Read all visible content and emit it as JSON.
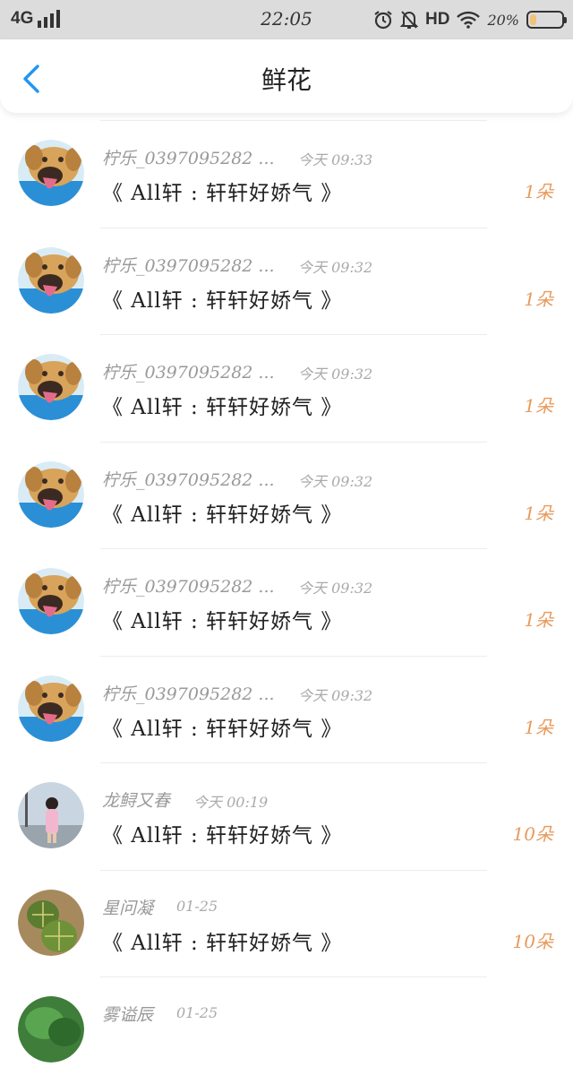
{
  "status_bar": {
    "network": "4G",
    "time": "22:05",
    "hd": "HD",
    "battery_text": "20%",
    "battery_level": 0.2
  },
  "nav": {
    "back_icon": "chevron-left-icon",
    "title": "鲜花",
    "accent_color": "#2196f3"
  },
  "records": [
    {
      "name": "柠乐_0397095282 ...",
      "time": "今天 09:33",
      "message": "《 All轩 :  轩轩好娇气 》",
      "count": "1朵",
      "avatar": "dog"
    },
    {
      "name": "柠乐_0397095282 ...",
      "time": "今天 09:32",
      "message": "《 All轩 :  轩轩好娇气 》",
      "count": "1朵",
      "avatar": "dog"
    },
    {
      "name": "柠乐_0397095282 ...",
      "time": "今天 09:32",
      "message": "《 All轩 :  轩轩好娇气 》",
      "count": "1朵",
      "avatar": "dog"
    },
    {
      "name": "柠乐_0397095282 ...",
      "time": "今天 09:32",
      "message": "《 All轩 :  轩轩好娇气 》",
      "count": "1朵",
      "avatar": "dog"
    },
    {
      "name": "柠乐_0397095282 ...",
      "time": "今天 09:32",
      "message": "《 All轩 :  轩轩好娇气 》",
      "count": "1朵",
      "avatar": "dog"
    },
    {
      "name": "柠乐_0397095282 ...",
      "time": "今天 09:32",
      "message": "《 All轩 :  轩轩好娇气 》",
      "count": "1朵",
      "avatar": "dog"
    },
    {
      "name": "龙鲟又春",
      "time": "今天 00:19",
      "message": "《 All轩 :  轩轩好娇气 》",
      "count": "10朵",
      "avatar": "girl"
    },
    {
      "name": "星问凝",
      "time": "01-25",
      "message": "《 All轩 :  轩轩好娇气 》",
      "count": "10朵",
      "avatar": "cactus"
    },
    {
      "name": "雾谥辰",
      "time": "01-25",
      "message": "",
      "count": "",
      "avatar": "plant"
    }
  ]
}
